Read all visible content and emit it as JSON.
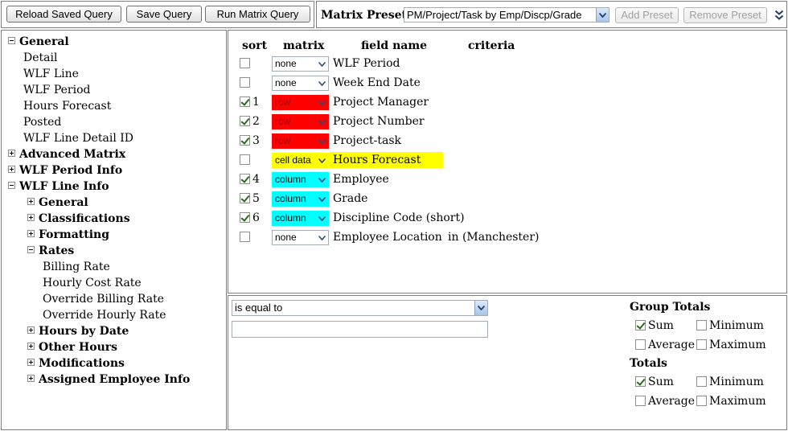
{
  "toolbar": {
    "reload_label": "Reload Saved Query",
    "save_label": "Save Query",
    "run_label": "Run Matrix Query"
  },
  "preset": {
    "label": "Matrix Preset:",
    "selected": "PM/Project/Task by Emp/Discp/Grade",
    "add_label": "Add Preset",
    "remove_label": "Remove Preset"
  },
  "tree": [
    {
      "label": "General",
      "toggle": "minus",
      "bold": true,
      "indent": 0
    },
    {
      "label": "Detail",
      "toggle": "",
      "bold": false,
      "indent": 1
    },
    {
      "label": "WLF Line",
      "toggle": "",
      "bold": false,
      "indent": 1
    },
    {
      "label": "WLF Period",
      "toggle": "",
      "bold": false,
      "indent": 1
    },
    {
      "label": "Hours Forecast",
      "toggle": "",
      "bold": false,
      "indent": 1
    },
    {
      "label": "Posted",
      "toggle": "",
      "bold": false,
      "indent": 1
    },
    {
      "label": "WLF Line Detail ID",
      "toggle": "",
      "bold": false,
      "indent": 1
    },
    {
      "label": "Advanced Matrix",
      "toggle": "plus",
      "bold": true,
      "indent": 0
    },
    {
      "label": "WLF Period Info",
      "toggle": "plus",
      "bold": true,
      "indent": 0
    },
    {
      "label": "WLF Line Info",
      "toggle": "minus",
      "bold": true,
      "indent": 0
    },
    {
      "label": "General",
      "toggle": "plus",
      "bold": true,
      "indent": 2
    },
    {
      "label": "Classifications",
      "toggle": "plus",
      "bold": true,
      "indent": 2
    },
    {
      "label": "Formatting",
      "toggle": "plus",
      "bold": true,
      "indent": 2
    },
    {
      "label": "Rates",
      "toggle": "minus",
      "bold": true,
      "indent": 2
    },
    {
      "label": "Billing Rate",
      "toggle": "",
      "bold": false,
      "indent": 3
    },
    {
      "label": "Hourly Cost Rate",
      "toggle": "",
      "bold": false,
      "indent": 3
    },
    {
      "label": "Override Billing Rate",
      "toggle": "",
      "bold": false,
      "indent": 3
    },
    {
      "label": "Override Hourly Rate",
      "toggle": "",
      "bold": false,
      "indent": 3
    },
    {
      "label": "Hours by Date",
      "toggle": "plus",
      "bold": true,
      "indent": 2
    },
    {
      "label": "Other Hours",
      "toggle": "plus",
      "bold": true,
      "indent": 2
    },
    {
      "label": "Modifications",
      "toggle": "plus",
      "bold": true,
      "indent": 2
    },
    {
      "label": "Assigned Employee Info",
      "toggle": "plus",
      "bold": true,
      "indent": 2
    }
  ],
  "fields": {
    "headers": {
      "sort": "sort",
      "matrix": "matrix",
      "field": "field name",
      "criteria": "criteria"
    },
    "rows": [
      {
        "checked": false,
        "sort": "",
        "matrix": "none",
        "color": "",
        "field": "WLF Period",
        "criteria": ""
      },
      {
        "checked": false,
        "sort": "",
        "matrix": "none",
        "color": "",
        "field": "Week End Date",
        "criteria": ""
      },
      {
        "checked": true,
        "sort": "1",
        "matrix": "row",
        "color": "red",
        "field": "Project Manager",
        "criteria": ""
      },
      {
        "checked": true,
        "sort": "2",
        "matrix": "row",
        "color": "red",
        "field": "Project Number",
        "criteria": ""
      },
      {
        "checked": true,
        "sort": "3",
        "matrix": "row",
        "color": "red",
        "field": "Project-task",
        "criteria": ""
      },
      {
        "checked": false,
        "sort": "",
        "matrix": "cell data",
        "color": "yellow",
        "field": "Hours Forecast",
        "criteria": ""
      },
      {
        "checked": true,
        "sort": "4",
        "matrix": "column",
        "color": "cyan",
        "field": "Employee",
        "criteria": ""
      },
      {
        "checked": true,
        "sort": "5",
        "matrix": "column",
        "color": "cyan",
        "field": "Grade",
        "criteria": ""
      },
      {
        "checked": true,
        "sort": "6",
        "matrix": "column",
        "color": "cyan",
        "field": "Discipline Code (short)",
        "criteria": ""
      },
      {
        "checked": false,
        "sort": "",
        "matrix": "none",
        "color": "",
        "field": "Employee Location",
        "criteria": "in (Manchester)"
      }
    ]
  },
  "criteria": {
    "operator": "is equal to",
    "value": ""
  },
  "totals": {
    "group_title": "Group Totals",
    "totals_title": "Totals",
    "group": [
      {
        "label": "Sum",
        "checked": true
      },
      {
        "label": "Minimum",
        "checked": false
      },
      {
        "label": "Average",
        "checked": false
      },
      {
        "label": "Maximum",
        "checked": false
      }
    ],
    "overall": [
      {
        "label": "Sum",
        "checked": true
      },
      {
        "label": "Minimum",
        "checked": false
      },
      {
        "label": "Average",
        "checked": false
      },
      {
        "label": "Maximum",
        "checked": false
      }
    ]
  },
  "colors": {
    "red": "#ff0000",
    "yellow": "#ffff00",
    "cyan": "#00ffff"
  },
  "icons": {
    "expand": "double-chevron-down-icon",
    "dropdown": "chevron-down-icon"
  }
}
